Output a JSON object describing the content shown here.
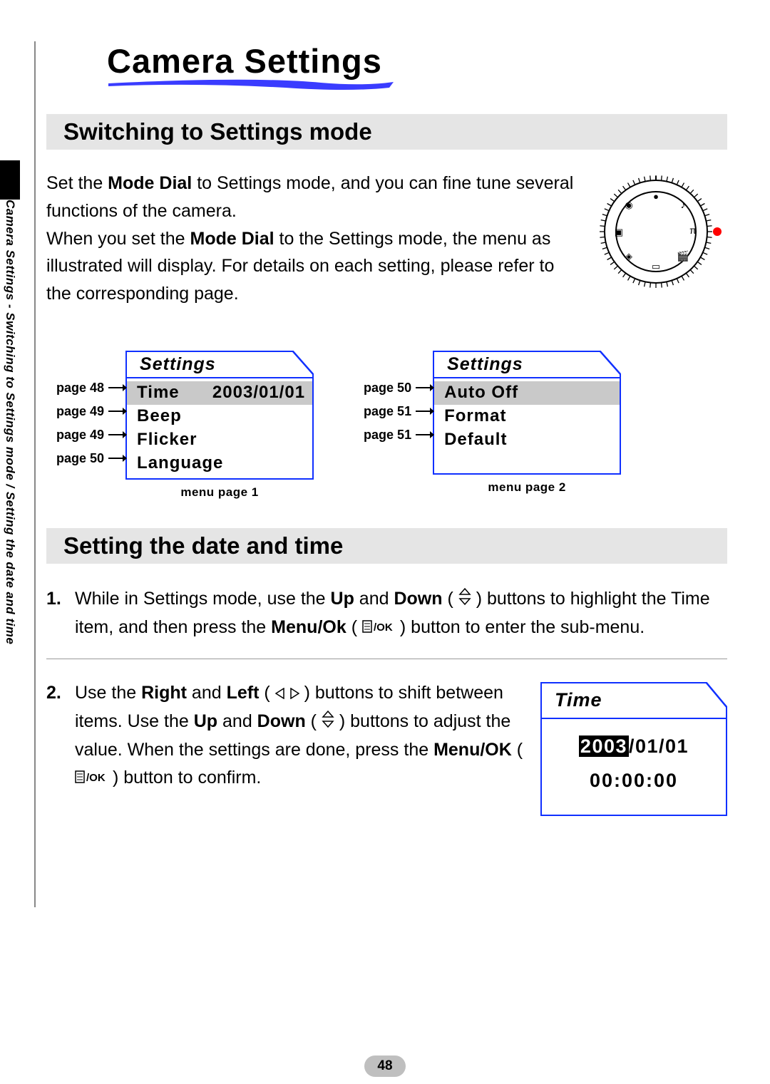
{
  "page_number": "48",
  "side_tab": "Camera Settings - Switching to Settings mode / Setting the date and time",
  "title": "Camera Settings",
  "section1": {
    "heading": "Switching to Settings mode",
    "intro_a1": "Set the ",
    "intro_a_bold1": "Mode Dial",
    "intro_a2": " to Settings mode, and you can fine tune several functions of the camera.",
    "intro_b1": "When you set the ",
    "intro_b_bold1": "Mode Dial",
    "intro_b2": " to the Settings mode, the menu as illustrated will display. For details on each setting, please refer to the corresponding page."
  },
  "menu1": {
    "header": "Settings",
    "caption": "menu page 1",
    "refs": [
      "page 48",
      "page 49",
      "page 49",
      "page 50"
    ],
    "rows": [
      {
        "label": "Time",
        "value": "2003/01/01",
        "sel": true
      },
      {
        "label": "Beep"
      },
      {
        "label": "Flicker"
      },
      {
        "label": "Language"
      }
    ]
  },
  "menu2": {
    "header": "Settings",
    "caption": "menu page 2",
    "refs": [
      "page 50",
      "page 51",
      "page 51"
    ],
    "rows": [
      {
        "label": "Auto Off",
        "sel": true
      },
      {
        "label": "Format"
      },
      {
        "label": "Default"
      }
    ]
  },
  "section2": {
    "heading": "Setting the date and time",
    "step1_num": "1.",
    "step1_a": "While in Settings mode, use the ",
    "step1_b1": "Up",
    "step1_and": " and ",
    "step1_b2": "Down",
    "step1_c": " ( ",
    "step1_d": " ) buttons to highlight the Time item, and then press the ",
    "step1_e": "Menu/Ok",
    "step1_f": " ( ",
    "step1_g": " ) button to enter the sub-menu.",
    "step2_num": "2.",
    "step2_a": "Use the ",
    "step2_b1": "Right",
    "step2_b2": "Left",
    "step2_c": " ( ",
    "step2_d": " ) buttons to shift between items. Use the ",
    "step2_e1": "Up",
    "step2_e2": "Down",
    "step2_f": " ( ",
    "step2_g": " ) buttons to adjust the value. When the settings are done, press the ",
    "step2_h": "Menu/OK",
    "step2_i": " ( ",
    "step2_j": " ) button to confirm."
  },
  "time_lcd": {
    "header": "Time",
    "year": "2003",
    "rest_date": "/01/01",
    "clock": "00:00:00"
  }
}
